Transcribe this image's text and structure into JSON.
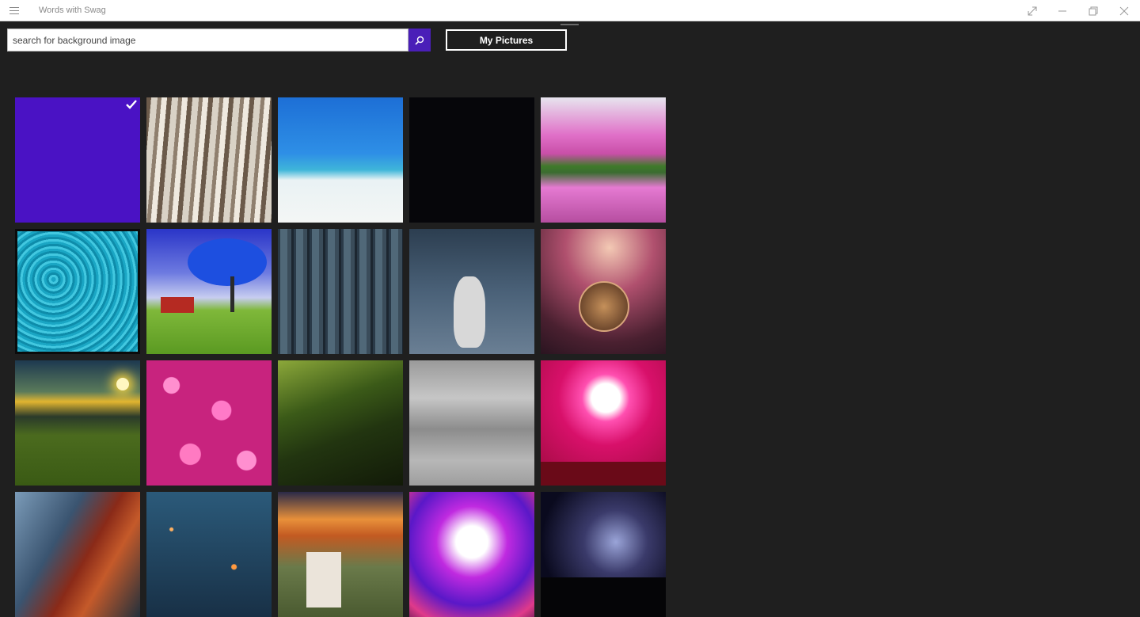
{
  "window": {
    "title": "Words with Swag"
  },
  "search": {
    "placeholder": "search for background image"
  },
  "buttons": {
    "my_pictures": "My Pictures"
  },
  "colors": {
    "accent": "#4a1fb8",
    "background": "#1f1f1f"
  },
  "icons": {
    "menu": "hamburger-icon",
    "search": "search-icon",
    "full_screen": "expand-icon",
    "minimize": "minimize-icon",
    "restore": "restore-icon",
    "close": "close-icon",
    "selected": "checkmark-icon"
  },
  "gallery": {
    "selected_index": 0,
    "tiles": [
      "solid purple",
      "tree bark",
      "palm beach",
      "solid black",
      "pink tree reflection",
      "teal grass",
      "blue tree barn",
      "wooden planks",
      "cat walking",
      "glass bubble",
      "sunset dandelions",
      "pink flowers",
      "forest stairs",
      "gray concrete",
      "heart glow",
      "iron man",
      "floating lanterns",
      "church sunset",
      "dancer splash",
      "milky way"
    ]
  }
}
